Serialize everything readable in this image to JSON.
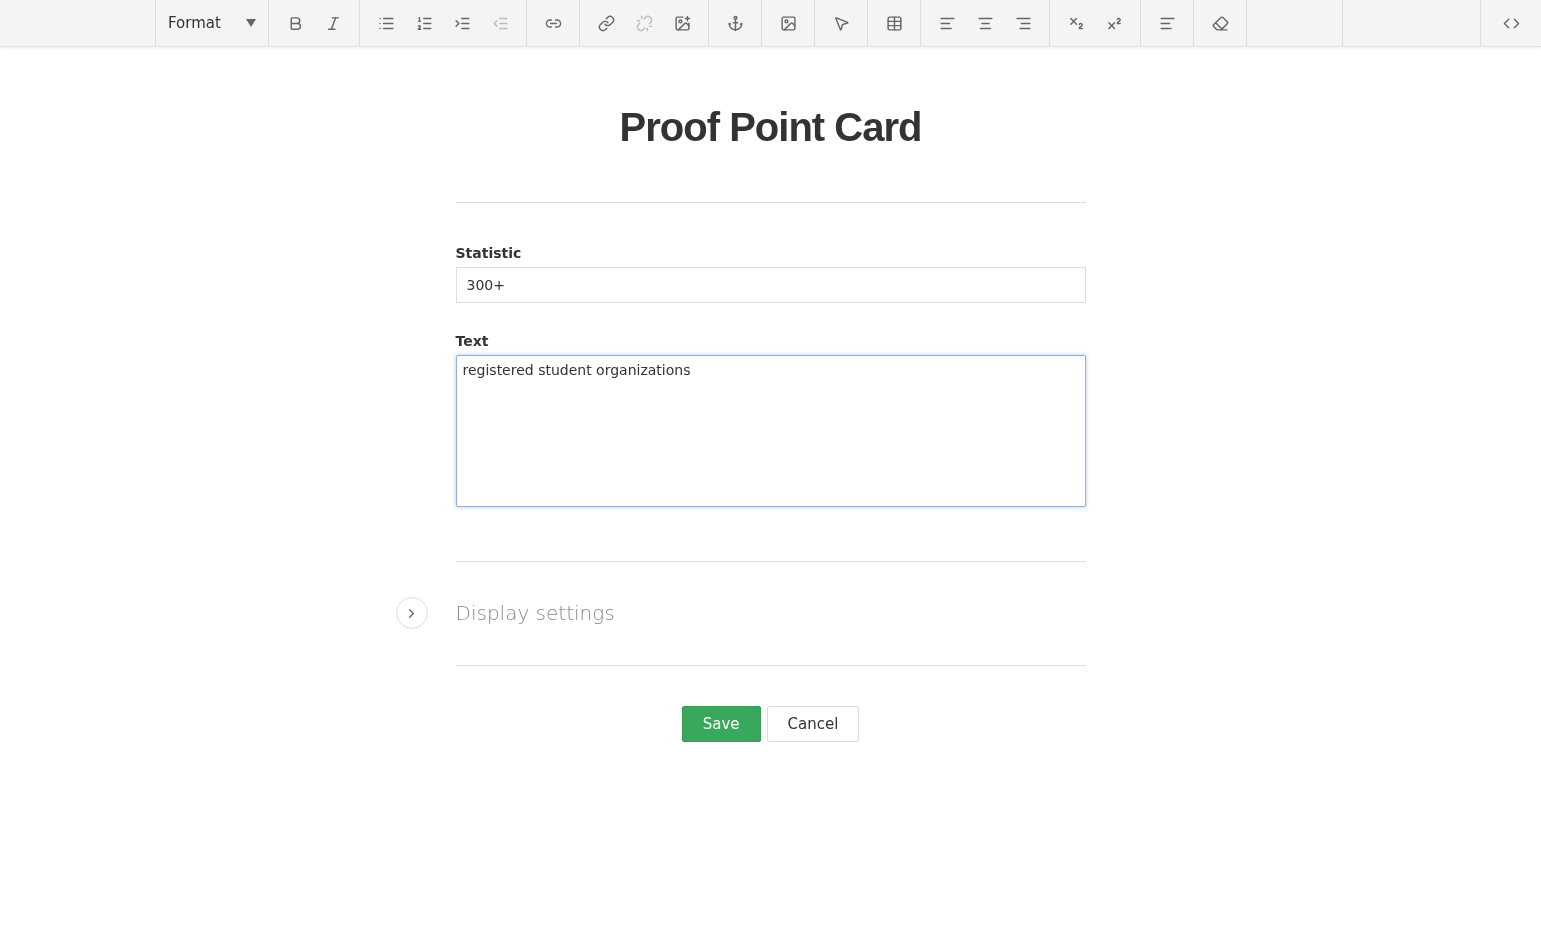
{
  "toolbar": {
    "format": {
      "label": "Format"
    },
    "groups": [
      {
        "buttons": [
          {
            "kind": "bold",
            "disabled": false
          },
          {
            "kind": "italic",
            "disabled": false
          }
        ]
      },
      {
        "buttons": [
          {
            "kind": "bullets",
            "disabled": false
          },
          {
            "kind": "numbers",
            "disabled": false
          },
          {
            "kind": "indent",
            "disabled": false
          },
          {
            "kind": "outdent",
            "disabled": true
          }
        ]
      },
      {
        "buttons": [
          {
            "kind": "chain",
            "disabled": false
          }
        ]
      },
      {
        "buttons": [
          {
            "kind": "link",
            "disabled": false
          },
          {
            "kind": "unlink",
            "disabled": true
          },
          {
            "kind": "image-add",
            "disabled": false
          }
        ]
      },
      {
        "buttons": [
          {
            "kind": "anchor",
            "disabled": false
          }
        ]
      },
      {
        "buttons": [
          {
            "kind": "image",
            "disabled": false
          }
        ]
      },
      {
        "buttons": [
          {
            "kind": "pointer",
            "disabled": false
          }
        ]
      },
      {
        "buttons": [
          {
            "kind": "table",
            "disabled": false
          }
        ]
      },
      {
        "buttons": [
          {
            "kind": "align-left",
            "disabled": false
          },
          {
            "kind": "align-center",
            "disabled": false
          },
          {
            "kind": "align-right",
            "disabled": false
          }
        ]
      },
      {
        "buttons": [
          {
            "kind": "subscript",
            "disabled": false
          },
          {
            "kind": "superscript",
            "disabled": false
          }
        ]
      },
      {
        "buttons": [
          {
            "kind": "paragraph",
            "disabled": false
          }
        ]
      },
      {
        "buttons": [
          {
            "kind": "clear",
            "disabled": false
          }
        ]
      },
      {
        "buttons": [
          {
            "kind": "code",
            "disabled": false
          }
        ]
      }
    ]
  },
  "title": "Proof Point Card",
  "fields": [
    {
      "label": "Statistic",
      "kind": "input",
      "value": "300+"
    },
    {
      "label": "Text",
      "kind": "textarea",
      "value": "registered student organizations",
      "focused": true
    }
  ],
  "display_settings": {
    "label": "Display settings",
    "expanded": false
  },
  "buttons": [
    {
      "label": "Save",
      "kind": "primary"
    },
    {
      "label": "Cancel",
      "kind": "secondary"
    }
  ]
}
